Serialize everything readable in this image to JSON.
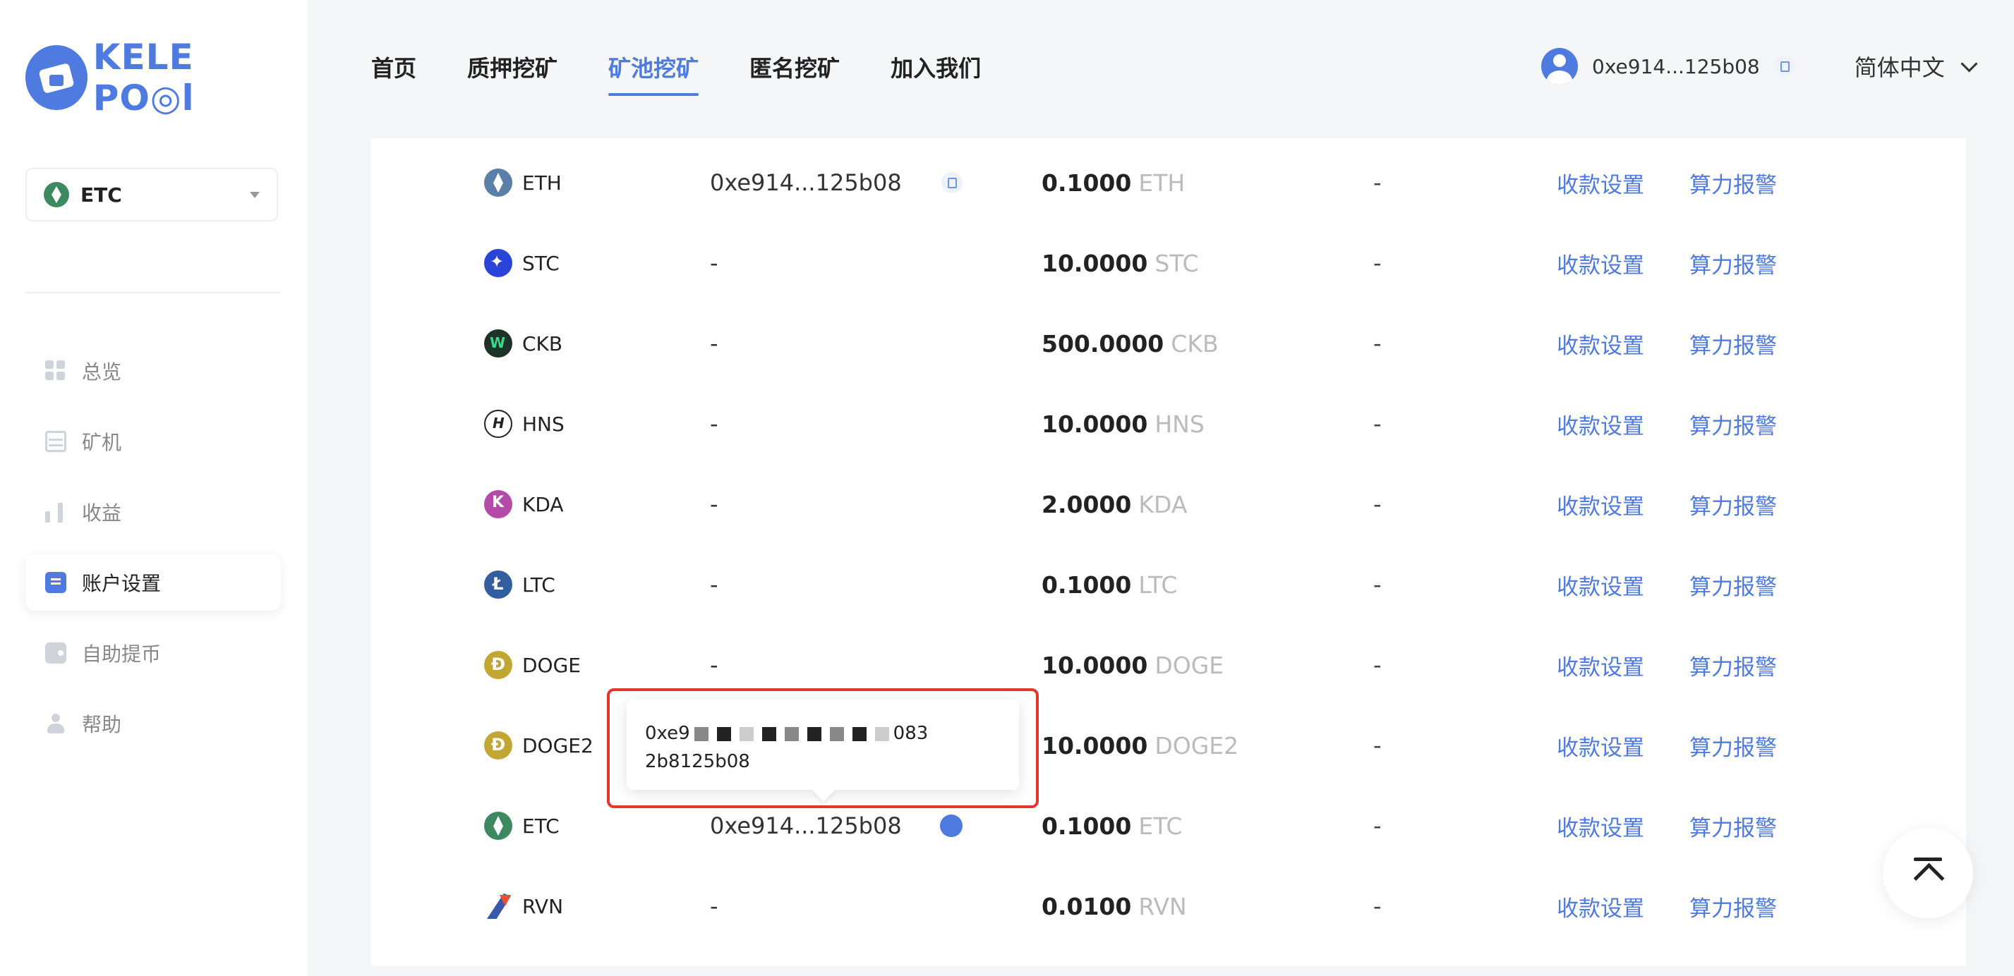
{
  "brand": {
    "logo_text": "KELE PO◎l"
  },
  "sidebar": {
    "coin_select": {
      "value": "ETC"
    },
    "items": [
      {
        "label": "总览",
        "icon": "overview-grid-icon"
      },
      {
        "label": "矿机",
        "icon": "miner-server-icon"
      },
      {
        "label": "收益",
        "icon": "earnings-bars-icon"
      },
      {
        "label": "账户设置",
        "icon": "account-settings-icon",
        "active": true
      },
      {
        "label": "自助提币",
        "icon": "wallet-icon"
      },
      {
        "label": "帮助",
        "icon": "help-user-icon"
      }
    ]
  },
  "header": {
    "nav": [
      {
        "label": "首页"
      },
      {
        "label": "质押挖矿"
      },
      {
        "label": "矿池挖矿",
        "active": true
      },
      {
        "label": "匿名挖矿"
      },
      {
        "label": "加入我们"
      }
    ],
    "user_address": "0xe914...125b08",
    "language": "简体中文"
  },
  "table": {
    "rows": [
      {
        "coin": "ETH",
        "icon": "eth-icon",
        "address": "0xe914...125b08",
        "min_value": "0.1000",
        "min_unit": "ETH",
        "dash": "-",
        "action1": "收款设置",
        "action2": "算力报警"
      },
      {
        "coin": "STC",
        "icon": "stc-icon",
        "address": "-",
        "min_value": "10.0000",
        "min_unit": "STC",
        "dash": "-",
        "action1": "收款设置",
        "action2": "算力报警"
      },
      {
        "coin": "CKB",
        "icon": "ckb-icon",
        "address": "-",
        "min_value": "500.0000",
        "min_unit": "CKB",
        "dash": "-",
        "action1": "收款设置",
        "action2": "算力报警"
      },
      {
        "coin": "HNS",
        "icon": "hns-icon",
        "address": "-",
        "min_value": "10.0000",
        "min_unit": "HNS",
        "dash": "-",
        "action1": "收款设置",
        "action2": "算力报警"
      },
      {
        "coin": "KDA",
        "icon": "kda-icon",
        "address": "-",
        "min_value": "2.0000",
        "min_unit": "KDA",
        "dash": "-",
        "action1": "收款设置",
        "action2": "算力报警"
      },
      {
        "coin": "LTC",
        "icon": "ltc-icon",
        "address": "-",
        "min_value": "0.1000",
        "min_unit": "LTC",
        "dash": "-",
        "action1": "收款设置",
        "action2": "算力报警"
      },
      {
        "coin": "DOGE",
        "icon": "doge-icon",
        "address": "-",
        "min_value": "10.0000",
        "min_unit": "DOGE",
        "dash": "-",
        "action1": "收款设置",
        "action2": "算力报警"
      },
      {
        "coin": "DOGE2",
        "icon": "doge-icon",
        "address": "",
        "min_value": "10.0000",
        "min_unit": "DOGE2",
        "dash": "-",
        "action1": "收款设置",
        "action2": "算力报警"
      },
      {
        "coin": "ETC",
        "icon": "etc-icon",
        "address": "0xe914...125b08",
        "min_value": "0.1000",
        "min_unit": "ETC",
        "dash": "-",
        "action1": "收款设置",
        "action2": "算力报警"
      },
      {
        "coin": "RVN",
        "icon": "rvn-icon",
        "address": "-",
        "min_value": "0.0100",
        "min_unit": "RVN",
        "dash": "-",
        "action1": "收款设置",
        "action2": "算力报警"
      }
    ]
  },
  "tooltip": {
    "line1_start": "0xe9",
    "line1_end": "083",
    "line2": "2b8125b08"
  },
  "colors": {
    "accent": "#4f7ae0",
    "highlight_border": "#e1382b"
  }
}
